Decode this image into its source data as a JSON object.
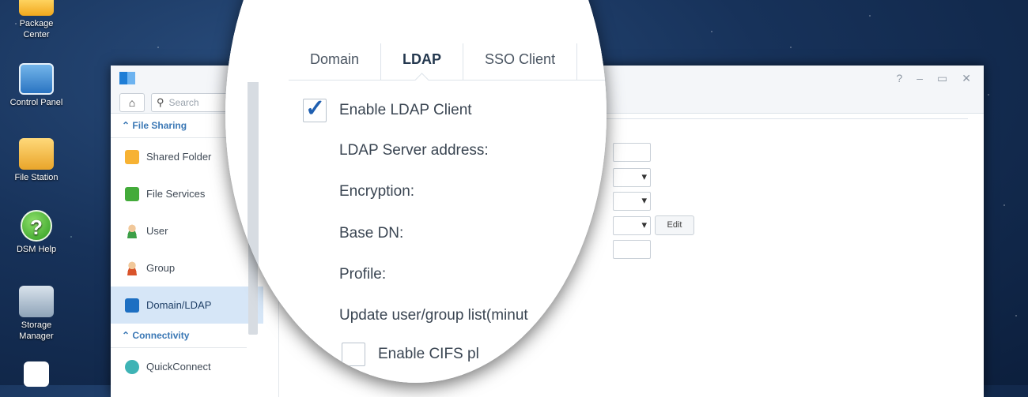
{
  "desktop": {
    "icons": [
      {
        "label": "Package\nCenter",
        "name": "package-center"
      },
      {
        "label": "Control Panel",
        "name": "control-panel"
      },
      {
        "label": "File Station",
        "name": "file-station"
      },
      {
        "label": "DSM Help",
        "name": "dsm-help"
      },
      {
        "label": "Storage\nManager",
        "name": "storage-manager"
      }
    ]
  },
  "window": {
    "controls": [
      "?",
      "–",
      "▭",
      "✕"
    ],
    "search_placeholder": "Search",
    "home_icon": "⌂"
  },
  "sidebar": {
    "group_file_sharing": "File Sharing",
    "items": [
      {
        "label": "Shared Folder",
        "icon": "folder-share-icon"
      },
      {
        "label": "File Services",
        "icon": "file-services-icon"
      },
      {
        "label": "User",
        "icon": "user-icon"
      },
      {
        "label": "Group",
        "icon": "group-icon"
      },
      {
        "label": "Domain/LDAP",
        "icon": "domain-ldap-icon"
      }
    ],
    "group_connectivity": "Connectivity",
    "connectivity_items": [
      {
        "label": "QuickConnect",
        "icon": "quickconnect-icon"
      }
    ]
  },
  "content": {
    "edit_label": "Edit"
  },
  "lens": {
    "tabs": [
      "Domain",
      "LDAP",
      "SSO Client"
    ],
    "active_tab": "LDAP",
    "enable_ldap_label": "Enable LDAP Client",
    "enable_ldap_checked": true,
    "labels": {
      "server": "LDAP Server address:",
      "encryption": "Encryption:",
      "base_dn": "Base DN:",
      "profile": "Profile:",
      "update": "Update user/group list(minut"
    },
    "cifs_label": "Enable CIFS pl"
  }
}
